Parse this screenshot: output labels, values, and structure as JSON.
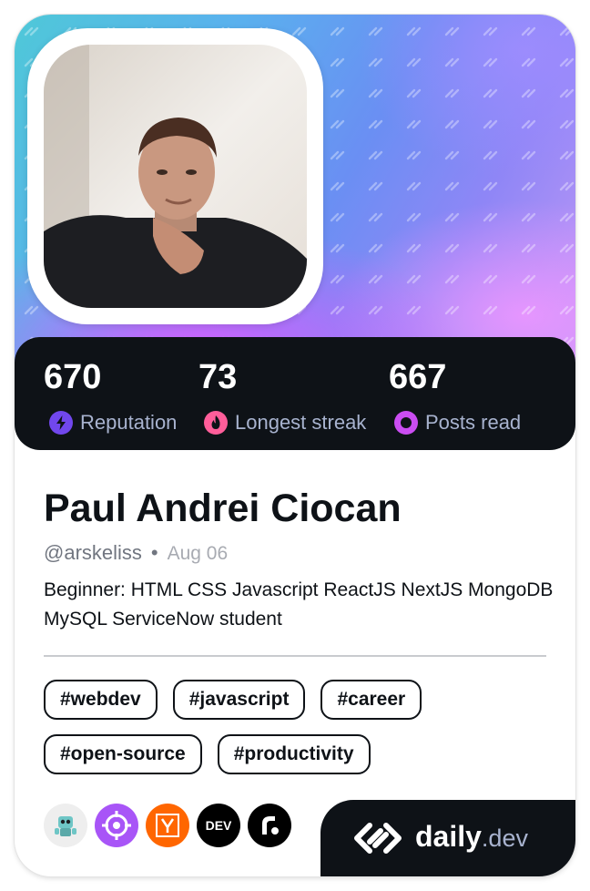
{
  "stats": [
    {
      "value": "670",
      "label": "Reputation",
      "icon": "reputation-bolt-icon",
      "color": "#7147ed"
    },
    {
      "value": "73",
      "label": "Longest streak",
      "icon": "streak-flame-icon",
      "color": "#ff5e9a"
    },
    {
      "value": "667",
      "label": "Posts read",
      "icon": "posts-read-ring-icon",
      "color": "#cb4df2"
    }
  ],
  "profile": {
    "name": "Paul Andrei Ciocan",
    "handle": "@arskeliss",
    "separator": "•",
    "date": "Aug 06",
    "bio": "Beginner: HTML CSS Javascript ReactJS NextJS MongoDB MySQL ServiceNow student"
  },
  "tags": [
    "#webdev",
    "#javascript",
    "#career",
    "#open-source",
    "#productivity"
  ],
  "sources": [
    {
      "name": "robot-avatar-icon",
      "bg": "#eeeeee"
    },
    {
      "name": "crosshair-source-icon",
      "bg": "#a855f7"
    },
    {
      "name": "y-combinator-icon",
      "bg": "#ff6600"
    },
    {
      "name": "dev-to-icon",
      "bg": "#000000",
      "text": "DEV"
    },
    {
      "name": "r-logo-icon",
      "bg": "#000000"
    }
  ],
  "brand": {
    "name_strong": "daily",
    "name_light": ".dev",
    "icon": "daily-dev-logo-icon"
  },
  "colors": {
    "card_dark": "#0e1217",
    "muted": "#a8b3cf",
    "text": "#0e1217"
  }
}
